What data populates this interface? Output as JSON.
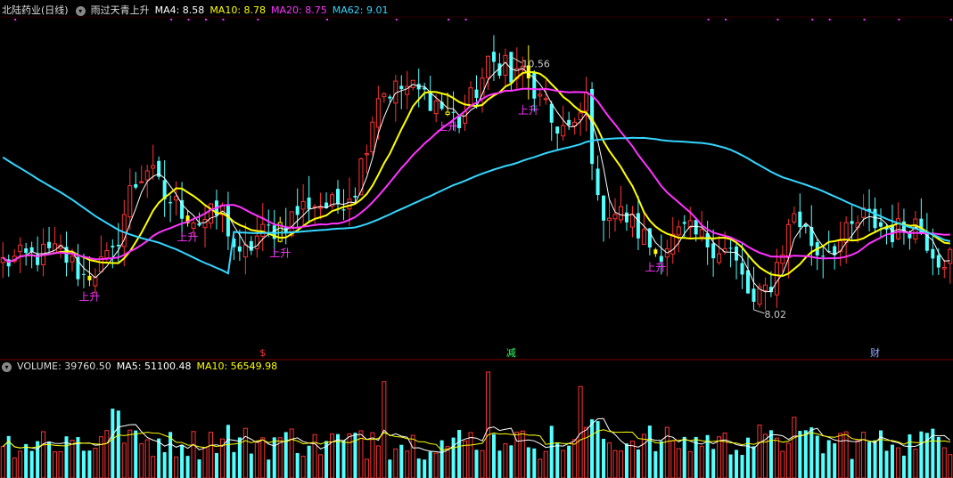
{
  "header": {
    "stock_name": "北陆药业(日线)",
    "indicator_name": "雨过天青上升",
    "ma4": "MA4: 8.58",
    "ma10": "MA10: 8.78",
    "ma20": "MA20: 8.75",
    "ma62": "MA62: 9.01"
  },
  "volume_header": {
    "volume": "VOLUME: 39760.50",
    "ma5": "MA5: 51100.48",
    "ma10": "MA10: 56549.98"
  },
  "colors": {
    "up": "#ff3333",
    "down": "#54ffff",
    "ma4": "#ffffff",
    "ma10": "#ffff00",
    "ma20": "#ff33ff",
    "ma62": "#33d6ff",
    "signal": "#ff33ff",
    "grid": "#800000"
  },
  "icons": [
    "collapse-circle-icon"
  ],
  "chart_data": [
    {
      "type": "candlestick",
      "series_names": [
        "MA4",
        "MA10",
        "MA20",
        "MA62"
      ],
      "annotations": [
        {
          "label": "10.56",
          "kind": "high"
        },
        {
          "label": "8.02",
          "kind": "low"
        }
      ],
      "signal_label": "上升",
      "signal_candles": [
        15,
        32,
        48,
        77,
        91,
        113
      ],
      "events": [
        {
          "label": "$",
          "index": 45,
          "color": "#ff3333"
        },
        {
          "label": "减",
          "index": 88,
          "color": "#33ff66"
        },
        {
          "label": "财",
          "index": 151,
          "color": "#99aaff"
        }
      ],
      "ylim": [
        7.6,
        10.95
      ],
      "anchors": [
        [
          0,
          8.5
        ],
        [
          10,
          8.6
        ],
        [
          14,
          8.35
        ],
        [
          19,
          8.55
        ],
        [
          22,
          9.2
        ],
        [
          25,
          9.45
        ],
        [
          28,
          9.15
        ],
        [
          34,
          8.9
        ],
        [
          38,
          9.0
        ],
        [
          41,
          8.5
        ],
        [
          44,
          8.75
        ],
        [
          49,
          8.9
        ],
        [
          53,
          9.1
        ],
        [
          57,
          9.05
        ],
        [
          61,
          9.25
        ],
        [
          65,
          10.2
        ],
        [
          70,
          10.25
        ],
        [
          74,
          10.15
        ],
        [
          79,
          9.9
        ],
        [
          84,
          10.45
        ],
        [
          88,
          10.56
        ],
        [
          92,
          10.2
        ],
        [
          95,
          9.9
        ],
        [
          99,
          9.8
        ],
        [
          101,
          10.15
        ],
        [
          103,
          9.05
        ],
        [
          108,
          8.95
        ],
        [
          113,
          8.6
        ],
        [
          118,
          8.8
        ],
        [
          126,
          8.6
        ],
        [
          130,
          8.05
        ],
        [
          133,
          8.3
        ],
        [
          137,
          9.0
        ],
        [
          141,
          8.6
        ],
        [
          145,
          8.7
        ],
        [
          149,
          8.95
        ],
        [
          154,
          8.8
        ],
        [
          158,
          8.9
        ],
        [
          162,
          8.55
        ]
      ]
    },
    {
      "type": "bar",
      "series_names": [
        "VOLUME",
        "MA5",
        "MA10"
      ],
      "ylim": [
        0,
        110000
      ],
      "spikes": [
        [
          19,
          72000
        ],
        [
          20,
          70000
        ],
        [
          66,
          100000
        ],
        [
          84,
          115000
        ],
        [
          100,
          95000
        ],
        [
          137,
          63000
        ]
      ]
    }
  ]
}
